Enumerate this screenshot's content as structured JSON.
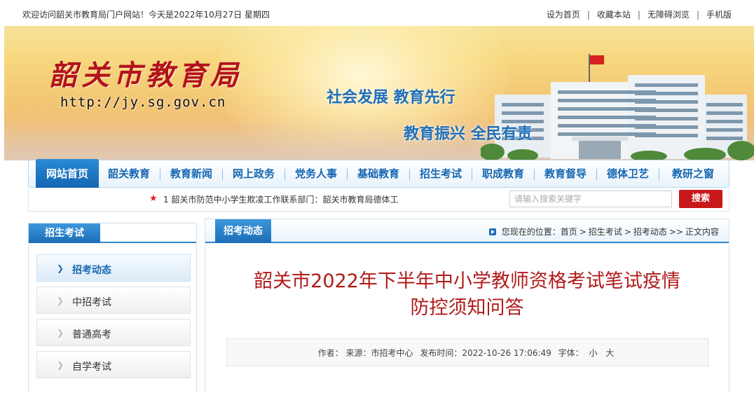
{
  "topbar": {
    "welcome": "欢迎访问韶关市教育局门户网站！今天是2022年10月27日 星期四",
    "links": [
      "设为首页",
      "收藏本站",
      "无障碍浏览",
      "手机版"
    ],
    "separator": "|"
  },
  "banner": {
    "title": "韶关市教育局",
    "url": "http://jy.sg.gov.cn",
    "slogan1": "社会发展  教育先行",
    "slogan2": "教育振兴  全民有责"
  },
  "nav": {
    "items": [
      "网站首页",
      "韶关教育",
      "教育新闻",
      "网上政务",
      "党务人事",
      "基础教育",
      "招生考试",
      "职成教育",
      "教育督导",
      "德体卫艺",
      "教研之窗"
    ],
    "active_index": 0
  },
  "ticker": {
    "text": "1 韶关市防范中小学生欺凌工作联系部门：韶关市教育局德体工",
    "search_placeholder": "请输入搜索关键字",
    "search_button": "搜索"
  },
  "sidebar": {
    "title": "招生考试",
    "items": [
      "招考动态",
      "中招考试",
      "普通高考",
      "自学考试"
    ],
    "active_index": 0
  },
  "main": {
    "tab": "招考动态",
    "breadcrumb": {
      "prefix": "您现在的位置：",
      "parts": [
        "首页",
        ">",
        "招生考试",
        ">",
        "招考动态",
        ">>",
        "正文内容"
      ]
    },
    "article": {
      "title_line1": "韶关市2022年下半年中小学教师资格考试笔试疫情",
      "title_line2": "防控须知问答",
      "meta": {
        "author_label": "作者：",
        "source_label": "来源：",
        "source": "市招考中心",
        "time_label": "发布时间：",
        "time": "2022-10-26 17:06:49",
        "font_label": "字体：",
        "font_small": "小",
        "font_large": "大"
      }
    }
  },
  "colors": {
    "brand_red": "#b3131b",
    "nav_blue": "#1566b1",
    "title_red": "#b11b1b",
    "search_red": "#c8181a"
  }
}
